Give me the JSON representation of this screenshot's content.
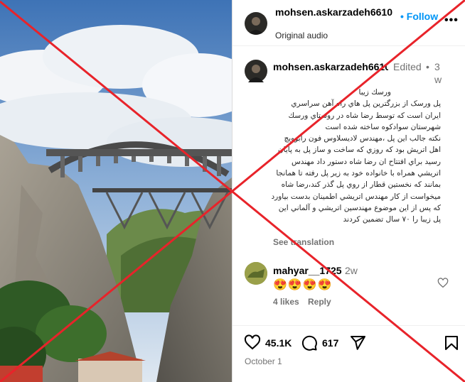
{
  "colors": {
    "accent": "#0095f6",
    "muted": "#737373",
    "red_x": "#e8232a"
  },
  "header": {
    "username": "mohsen.askarzadeh6610",
    "subtitle": "Original audio",
    "follow_label": "Follow",
    "more_icon": "more-horizontal-icon"
  },
  "caption": {
    "username": "mohsen.askarzadeh6610",
    "edited": "Edited",
    "dot": "•",
    "time": "3w",
    "lines": [
      "ورسك زيبا",
      "پل ورسک از بزرگترين پل هاي راه آهن سراسري",
      "ايران است که توسط رضا شاه در روستاي ورسك",
      "شهرستان سوادکوه ساخته شده است",
      "نکته جالب اين پل ،مهندس لاديسلاوس فون رابوويچ",
      "اهل اتريش بود که روزي که ساخت و ساز پل به پايان",
      "رسيد براي افتتاح ان رضا شاه دستور داد مهندس",
      "اتريشي همراه با خانواده خود به زير پل رفته تا همانجا",
      "بمانند که نخستين قطار از روي پل گذر کند،رضا شاه",
      "ميخواست از کار مهندس اتريشي اطمينان بدست بياورد",
      "كه پس از اين موضوع مهندسين اتريشي و آلماني اين",
      "پل زيبا را ۷۰ سال تضمين كردند"
    ],
    "see_translation": "See translation"
  },
  "comment": {
    "username": "mahyar__1725",
    "time": "2w",
    "text": "😍😍😍😍",
    "likes": "4 likes",
    "reply": "Reply"
  },
  "actions": {
    "likes_count": "45.1K",
    "comments_count": "617",
    "date": "October 1"
  }
}
